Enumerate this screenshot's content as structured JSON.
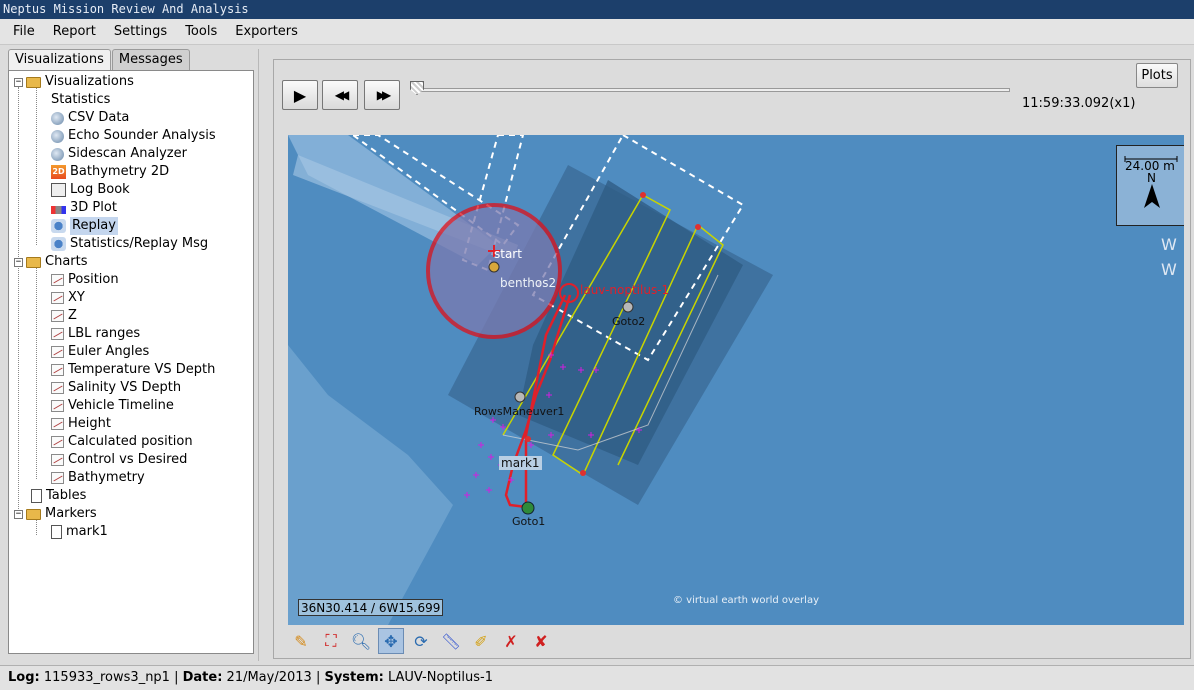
{
  "window": {
    "title": "Neptus Mission Review And Analysis"
  },
  "menu": [
    "File",
    "Report",
    "Settings",
    "Tools",
    "Exporters"
  ],
  "tabs": [
    "Visualizations",
    "Messages"
  ],
  "tree": {
    "visualizations": "Visualizations",
    "viz_items": [
      "Statistics",
      "CSV Data",
      "Echo Sounder Analysis",
      "Sidescan Analyzer",
      "Bathymetry 2D",
      "Log Book",
      "3D Plot",
      "Replay",
      "Statistics/Replay Msg"
    ],
    "charts": "Charts",
    "chart_items": [
      "Position",
      "XY",
      "Z",
      "LBL ranges",
      "Euler Angles",
      "Temperature VS Depth",
      "Salinity VS Depth",
      "Vehicle Timeline",
      "Height",
      "Calculated position",
      "Control vs Desired",
      "Bathymetry"
    ],
    "tables": "Tables",
    "markers": "Markers",
    "marker_items": [
      "mark1"
    ]
  },
  "playback": {
    "play": "▶",
    "rewind": "◀◀",
    "forward": "▶▶",
    "plots_label": "Plots",
    "time": "11:59:33.092(x1)",
    "progress": 0.0
  },
  "map": {
    "coordinates": "36N30.414 / 6W15.699",
    "credit": "© virtual earth world overlay",
    "scale": "24.00 m",
    "north": "N",
    "labels": {
      "start": "start",
      "benthos": "benthos2",
      "vehicle": "lauv-noptilus-1",
      "goto2": "Goto2",
      "rows": "RowsManeuver1",
      "mark": "mark1",
      "goto1": "Goto1"
    },
    "colors": {
      "water": "#4f8cc0",
      "track": "#e0202a",
      "rows": "#c8d400",
      "markers": "#d020e0"
    }
  },
  "status": {
    "log_label": "Log:",
    "log_value": "115933_rows3_np1",
    "date_label": "Date:",
    "date_value": "21/May/2013",
    "system_label": "System:",
    "system_value": "LAUV-Noptilus-1"
  }
}
